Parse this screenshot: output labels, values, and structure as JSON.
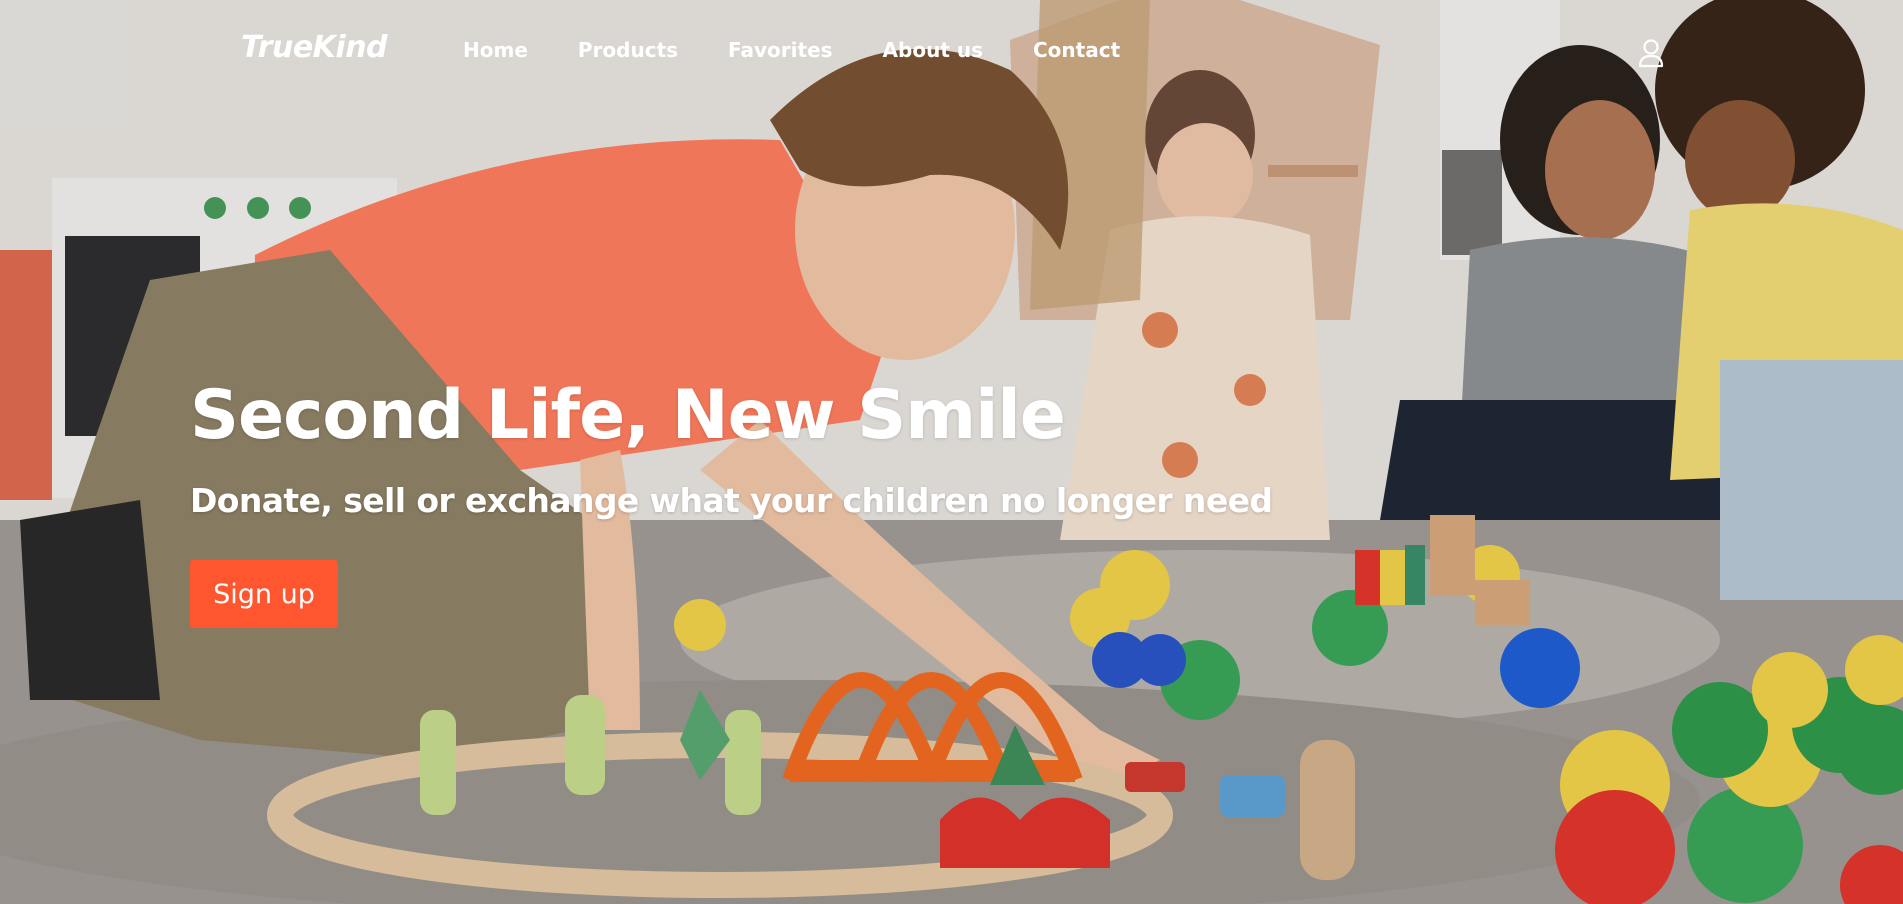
{
  "brand": {
    "logo_text": "TrueKind"
  },
  "nav": {
    "items": [
      {
        "label": "Home"
      },
      {
        "label": "Products"
      },
      {
        "label": "Favorites"
      },
      {
        "label": "About us"
      },
      {
        "label": "Contact"
      }
    ],
    "account_icon": "user-icon"
  },
  "hero": {
    "headline": "Second Life, New Smile",
    "subheadline": "Donate, sell or exchange what your children no longer need",
    "cta_label": "Sign up",
    "background": "photo of children playing with toys on a carpet",
    "accent_color": "#ff5630"
  }
}
